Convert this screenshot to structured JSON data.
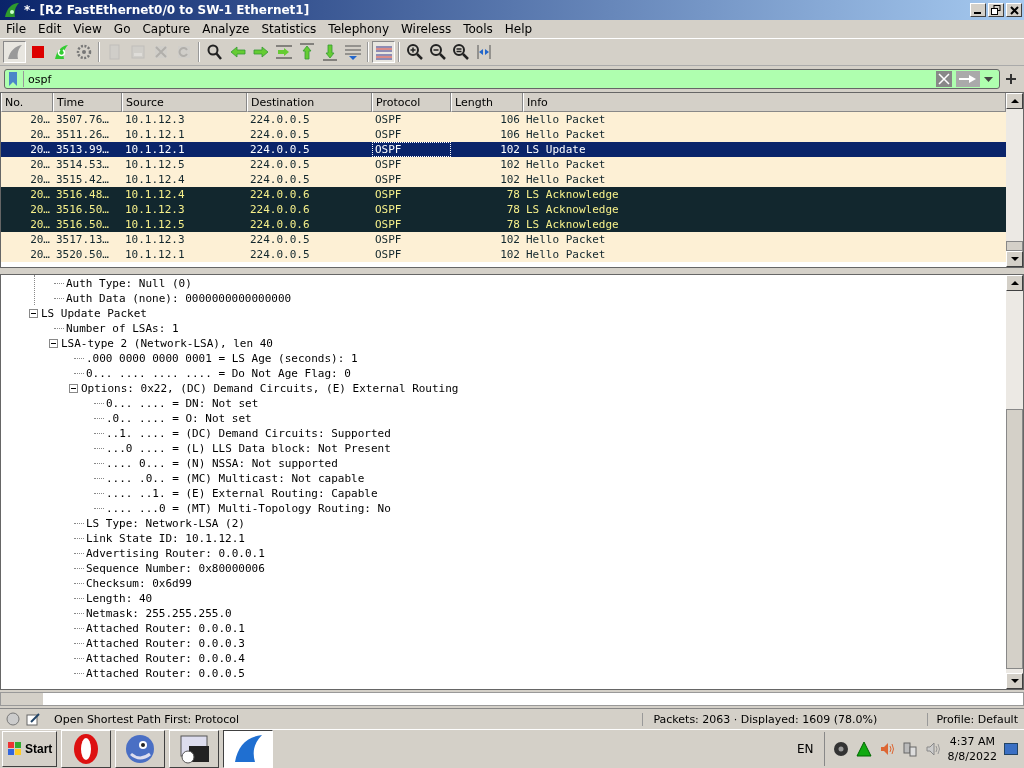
{
  "window": {
    "title": "*- [R2 FastEthernet0/0 to SW-1 Ethernet1]"
  },
  "menu": [
    "File",
    "Edit",
    "View",
    "Go",
    "Capture",
    "Analyze",
    "Statistics",
    "Telephony",
    "Wireless",
    "Tools",
    "Help"
  ],
  "toolbar": [
    {
      "kind": "fin",
      "disabled": false,
      "selected": true
    },
    {
      "kind": "stop",
      "disabled": false,
      "selected": false
    },
    {
      "kind": "restart",
      "disabled": false,
      "selected": false
    },
    {
      "kind": "gear",
      "disabled": false,
      "selected": false
    },
    {
      "kind": "sep"
    },
    {
      "kind": "open",
      "disabled": true,
      "selected": false
    },
    {
      "kind": "save",
      "disabled": true,
      "selected": false
    },
    {
      "kind": "close",
      "disabled": true,
      "selected": false
    },
    {
      "kind": "reload",
      "disabled": true,
      "selected": false
    },
    {
      "kind": "sep"
    },
    {
      "kind": "search",
      "disabled": false,
      "selected": false
    },
    {
      "kind": "back",
      "disabled": false,
      "selected": false
    },
    {
      "kind": "forward",
      "disabled": false,
      "selected": false
    },
    {
      "kind": "goto",
      "disabled": false,
      "selected": false
    },
    {
      "kind": "top",
      "disabled": false,
      "selected": false
    },
    {
      "kind": "bottom",
      "disabled": false,
      "selected": false
    },
    {
      "kind": "autoscroll",
      "disabled": false,
      "selected": false
    },
    {
      "kind": "sep"
    },
    {
      "kind": "colorize",
      "disabled": false,
      "selected": true
    },
    {
      "kind": "sep"
    },
    {
      "kind": "zoomin",
      "disabled": false,
      "selected": false
    },
    {
      "kind": "zoomout",
      "disabled": false,
      "selected": false
    },
    {
      "kind": "zoomreset",
      "disabled": false,
      "selected": false
    },
    {
      "kind": "resize",
      "disabled": false,
      "selected": false
    }
  ],
  "filter": {
    "value": "ospf"
  },
  "packet_list": {
    "columns": [
      "No.",
      "Time",
      "Source",
      "Destination",
      "Protocol",
      "Length",
      "Info"
    ],
    "rows": [
      {
        "no": "20…",
        "time": "3507.76…",
        "source": "10.1.12.3",
        "destination": "224.0.0.5",
        "protocol": "OSPF",
        "length": "106",
        "info": "Hello Packet",
        "color": "#fdf0d5",
        "selected": false
      },
      {
        "no": "20…",
        "time": "3511.26…",
        "source": "10.1.12.1",
        "destination": "224.0.0.5",
        "protocol": "OSPF",
        "length": "106",
        "info": "Hello Packet",
        "color": "#fdf0d5",
        "selected": false
      },
      {
        "no": "20…",
        "time": "3513.99…",
        "source": "10.1.12.1",
        "destination": "224.0.0.5",
        "protocol": "OSPF",
        "length": "102",
        "info": "LS Update",
        "selected": true
      },
      {
        "no": "20…",
        "time": "3514.53…",
        "source": "10.1.12.5",
        "destination": "224.0.0.5",
        "protocol": "OSPF",
        "length": "102",
        "info": "Hello Packet",
        "color": "#fdf0d5",
        "selected": false
      },
      {
        "no": "20…",
        "time": "3515.42…",
        "source": "10.1.12.4",
        "destination": "224.0.0.5",
        "protocol": "OSPF",
        "length": "102",
        "info": "Hello Packet",
        "color": "#fdf0d5",
        "selected": false
      },
      {
        "no": "20…",
        "time": "3516.48…",
        "source": "10.1.12.4",
        "destination": "224.0.0.6",
        "protocol": "OSPF",
        "length": "78",
        "info": "LS Acknowledge",
        "color": "#12272e",
        "selected": false
      },
      {
        "no": "20…",
        "time": "3516.50…",
        "source": "10.1.12.3",
        "destination": "224.0.0.6",
        "protocol": "OSPF",
        "length": "78",
        "info": "LS Acknowledge",
        "color": "#12272e",
        "selected": false
      },
      {
        "no": "20…",
        "time": "3516.50…",
        "source": "10.1.12.5",
        "destination": "224.0.0.6",
        "protocol": "OSPF",
        "length": "78",
        "info": "LS Acknowledge",
        "color": "#12272e",
        "selected": false
      },
      {
        "no": "20…",
        "time": "3517.13…",
        "source": "10.1.12.3",
        "destination": "224.0.0.5",
        "protocol": "OSPF",
        "length": "102",
        "info": "Hello Packet",
        "color": "#fdf0d5",
        "selected": false
      },
      {
        "no": "20…",
        "time": "3520.50…",
        "source": "10.1.12.1",
        "destination": "224.0.0.5",
        "protocol": "OSPF",
        "length": "102",
        "info": "Hello Packet",
        "color": "#fdf0d5",
        "selected": false
      }
    ]
  },
  "details": {
    "continued": [
      "Auth Type: Null (0)",
      "Auth Data (none): 0000000000000000"
    ],
    "nodes": [
      {
        "label": "LS Update Packet",
        "expanded": true,
        "children": [
          {
            "label": "Number of LSAs: 1"
          },
          {
            "label": "LSA-type 2 (Network-LSA), len 40",
            "expanded": true,
            "children": [
              {
                "label": ".000 0000 0000 0001 = LS Age (seconds): 1"
              },
              {
                "label": "0... .... .... .... = Do Not Age Flag: 0"
              },
              {
                "label": "Options: 0x22, (DC) Demand Circuits, (E) External Routing",
                "expanded": true,
                "children": [
                  {
                    "label": "0... .... = DN: Not set"
                  },
                  {
                    "label": ".0.. .... = O: Not set"
                  },
                  {
                    "label": "..1. .... = (DC) Demand Circuits: Supported"
                  },
                  {
                    "label": "...0 .... = (L) LLS Data block: Not Present"
                  },
                  {
                    "label": ".... 0... = (N) NSSA: Not supported"
                  },
                  {
                    "label": ".... .0.. = (MC) Multicast: Not capable"
                  },
                  {
                    "label": ".... ..1. = (E) External Routing: Capable"
                  },
                  {
                    "label": ".... ...0 = (MT) Multi-Topology Routing: No"
                  }
                ]
              },
              {
                "label": "LS Type: Network-LSA (2)"
              },
              {
                "label": "Link State ID: 10.1.12.1"
              },
              {
                "label": "Advertising Router: 0.0.0.1"
              },
              {
                "label": "Sequence Number: 0x80000006"
              },
              {
                "label": "Checksum: 0x6d99"
              },
              {
                "label": "Length: 40"
              },
              {
                "label": "Netmask: 255.255.255.0"
              },
              {
                "label": "Attached Router: 0.0.0.1"
              },
              {
                "label": "Attached Router: 0.0.0.3"
              },
              {
                "label": "Attached Router: 0.0.0.4"
              },
              {
                "label": "Attached Router: 0.0.0.5"
              }
            ]
          }
        ]
      }
    ]
  },
  "status_bar": {
    "field": "Open Shortest Path First: Protocol",
    "packets": "Packets: 2063 · Displayed: 1609 (78.0%)",
    "profile": "Profile: Default"
  },
  "taskbar": {
    "start": "Start",
    "apps": [
      {
        "kind": "opera",
        "selected": false
      },
      {
        "kind": "chameleon",
        "selected": false
      },
      {
        "kind": "window",
        "selected": false
      },
      {
        "kind": "fin",
        "selected": true
      }
    ],
    "language": "EN",
    "time": "4:37 AM",
    "date": "8/8/2022"
  }
}
